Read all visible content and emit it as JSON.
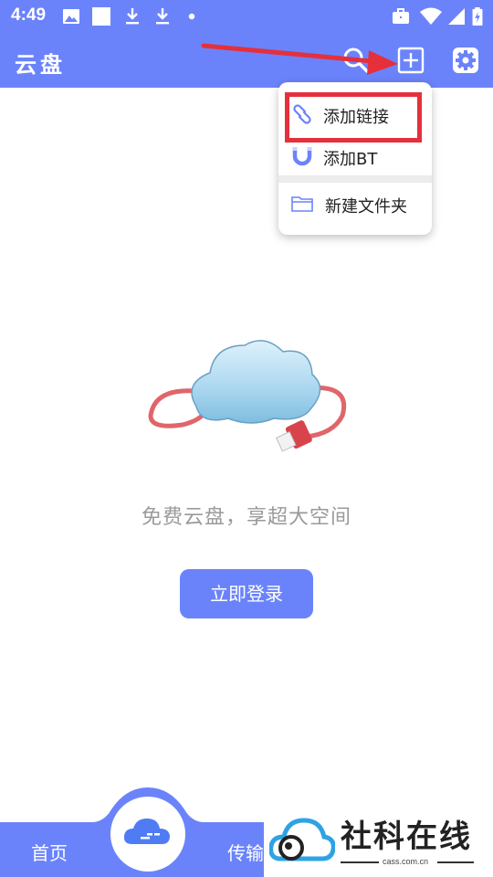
{
  "status_bar": {
    "time": "4:49",
    "icons": [
      "image-icon",
      "square-icon",
      "download-icon",
      "download-icon",
      "dot-icon",
      "briefcase-icon",
      "wifi-icon",
      "signal-icon",
      "battery-charging-icon"
    ]
  },
  "app_bar": {
    "title": "云盘",
    "actions": [
      "search-icon",
      "add-square-icon",
      "settings-gear-icon"
    ]
  },
  "dropdown_menu": {
    "items": [
      {
        "label": "添加链接",
        "icon": "link-icon"
      },
      {
        "label": "添加BT",
        "icon": "magnet-icon"
      },
      {
        "label": "新建文件夹",
        "icon": "folder-icon"
      }
    ]
  },
  "main": {
    "tagline": "免费云盘，享超大空间",
    "login_button": "立即登录"
  },
  "bottom_nav": {
    "home_label": "首页",
    "transfer_label": "传输",
    "center_icon": "cloud-icon"
  },
  "watermark": {
    "text": "社科在线",
    "url": "cass.com.cn"
  },
  "colors": {
    "primary": "#6b83fa",
    "annotation_red": "#e5303c",
    "tagline_gray": "#9a9a9a"
  }
}
